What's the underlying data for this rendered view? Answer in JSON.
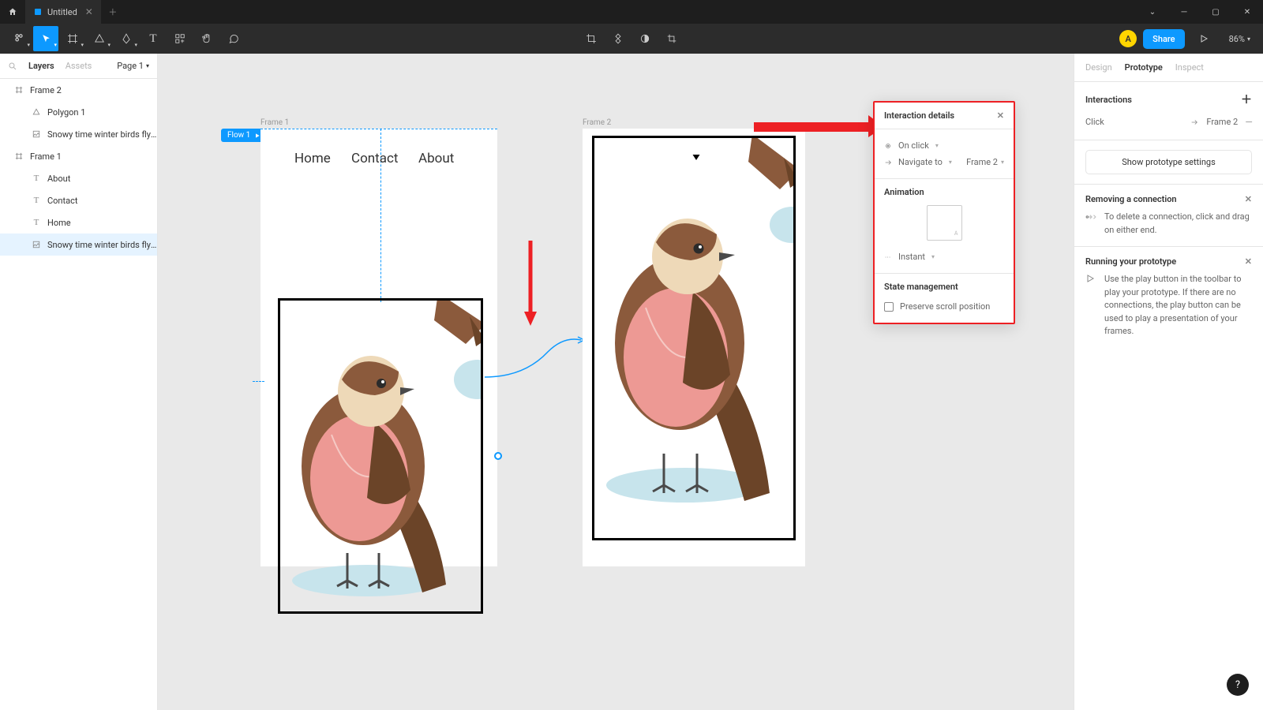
{
  "titlebar": {
    "doc_title": "Untitled",
    "avatar": "A"
  },
  "toolbar": {
    "share": "Share",
    "zoom": "86%"
  },
  "left_tabs": {
    "layers": "Layers",
    "assets": "Assets",
    "page": "Page 1"
  },
  "layers": [
    {
      "type": "frame",
      "name": "Frame 2"
    },
    {
      "type": "polygon",
      "name": "Polygon 1",
      "child": true
    },
    {
      "type": "image",
      "name": "Snowy time winter birds flying...",
      "child": true
    },
    {
      "type": "frame",
      "name": "Frame 1"
    },
    {
      "type": "text",
      "name": "About",
      "child": true
    },
    {
      "type": "text",
      "name": "Contact",
      "child": true
    },
    {
      "type": "text",
      "name": "Home",
      "child": true
    },
    {
      "type": "image",
      "name": "Snowy time winter birds flying...",
      "child": true,
      "selected": true
    }
  ],
  "canvas": {
    "flow_badge": "Flow 1",
    "frame1_label": "Frame 1",
    "frame2_label": "Frame 2",
    "nav": [
      "Home",
      "Contact",
      "About"
    ]
  },
  "right_tabs": {
    "design": "Design",
    "prototype": "Prototype",
    "inspect": "Inspect"
  },
  "interactions": {
    "title": "Interactions",
    "trigger": "Click",
    "target": "Frame 2",
    "proto_settings": "Show prototype settings"
  },
  "help1": {
    "title": "Removing a connection",
    "body": "To delete a connection, click and drag on either end."
  },
  "help2": {
    "title": "Running your prototype",
    "body": "Use the play button in the toolbar to play your prototype. If there are no connections, the play button can be used to play a presentation of your frames."
  },
  "popover": {
    "title": "Interaction details",
    "trigger": "On click",
    "action": "Navigate to",
    "target": "Frame 2",
    "animation_title": "Animation",
    "animation_type": "Instant",
    "state_title": "State management",
    "preserve": "Preserve scroll position"
  }
}
